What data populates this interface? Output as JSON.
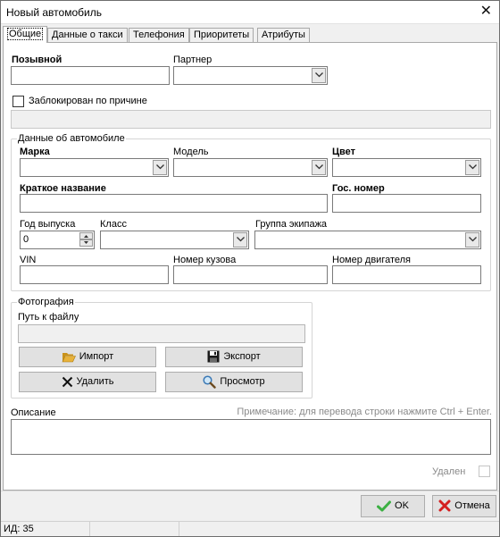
{
  "window": {
    "title": "Новый автомобиль",
    "close_glyph": "✕"
  },
  "tabs": [
    {
      "label": "Общие",
      "active": true
    },
    {
      "label": "Данные о такси"
    },
    {
      "label": "Телефония"
    },
    {
      "label": "Приоритеты"
    },
    {
      "label": "Атрибуты"
    }
  ],
  "general": {
    "callsign_label": "Позывной",
    "callsign_value": "",
    "partner_label": "Партнер",
    "partner_value": "",
    "blocked_label": "Заблокирован по причине",
    "blocked_checked": false,
    "blocked_reason_value": ""
  },
  "car": {
    "group_title": "Данные об автомобиле",
    "brand_label": "Марка",
    "model_label": "Модель",
    "color_label": "Цвет",
    "short_name_label": "Краткое название",
    "plate_label": "Гос. номер",
    "year_label": "Год выпуска",
    "year_value": "0",
    "class_label": "Класс",
    "crew_group_label": "Группа экипажа",
    "vin_label": "VIN",
    "body_number_label": "Номер кузова",
    "engine_number_label": "Номер двигателя"
  },
  "photo": {
    "group_title": "Фотография",
    "path_label": "Путь к файлу",
    "path_value": "",
    "import_label": "Импорт",
    "export_label": "Экспорт",
    "delete_label": "Удалить",
    "view_label": "Просмотр"
  },
  "description": {
    "label": "Описание",
    "hint": "Примечание: для перевода строки нажмите Ctrl + Enter.",
    "value": ""
  },
  "deleted": {
    "label": "Удален",
    "checked": false
  },
  "footer": {
    "ok_label": "OK",
    "cancel_label": "Отмена"
  },
  "status": {
    "id_text": "ИД: 35"
  },
  "colors": {
    "ok_check": "#3cb043",
    "cancel_x": "#d42020",
    "folder": "#e8b23a"
  }
}
